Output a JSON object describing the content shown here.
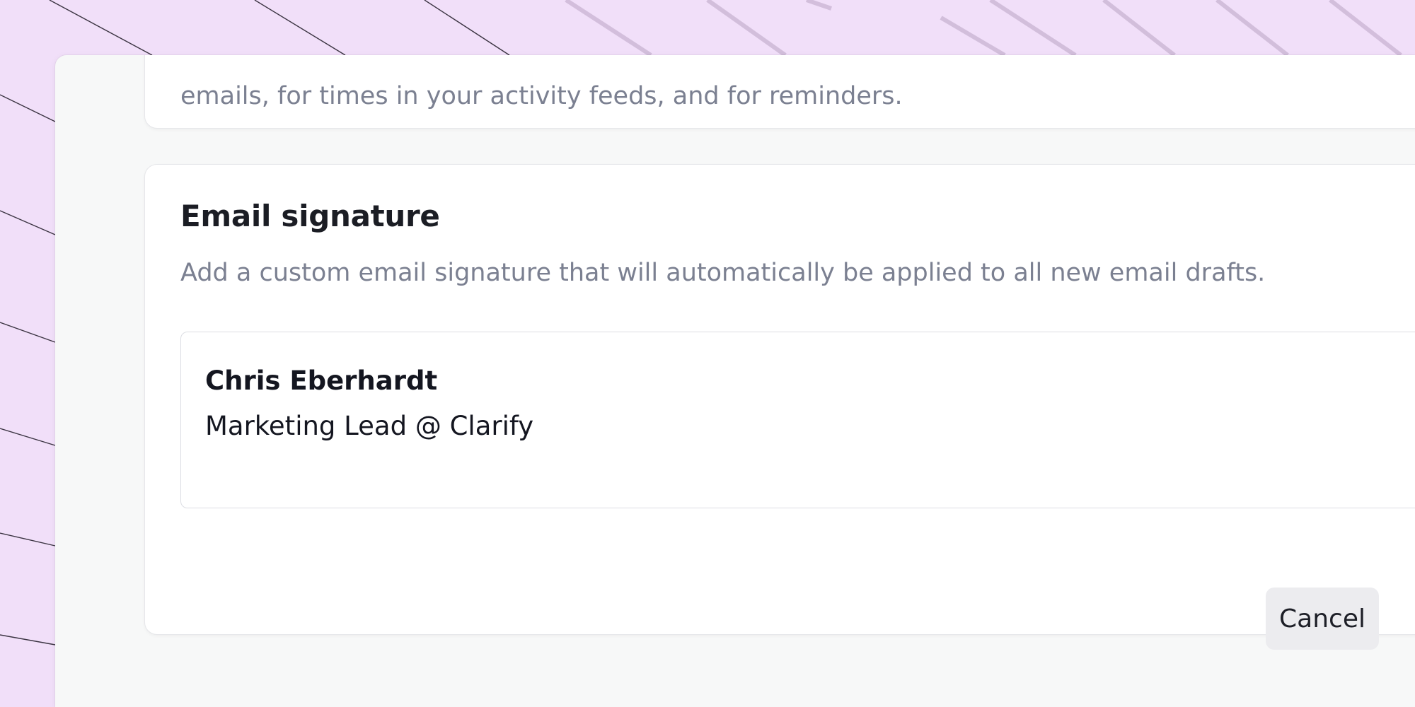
{
  "timezone_card": {
    "description_tail": "emails, for times in your activity feeds, and for reminders."
  },
  "signature_card": {
    "title": "Email signature",
    "description": "Add a custom email signature that will automatically be applied to all new email drafts.",
    "editor": {
      "name_line": "Chris Eberhardt",
      "role_line": "Marketing Lead @ Clarify"
    },
    "cancel_label": "Cancel"
  },
  "colors": {
    "backdrop": "#f1dff9",
    "window_bg": "#f7f8f8",
    "card_bg": "#ffffff",
    "muted_text": "#7b8091",
    "heading_text": "#1b1d24",
    "button_bg": "#ececef"
  }
}
